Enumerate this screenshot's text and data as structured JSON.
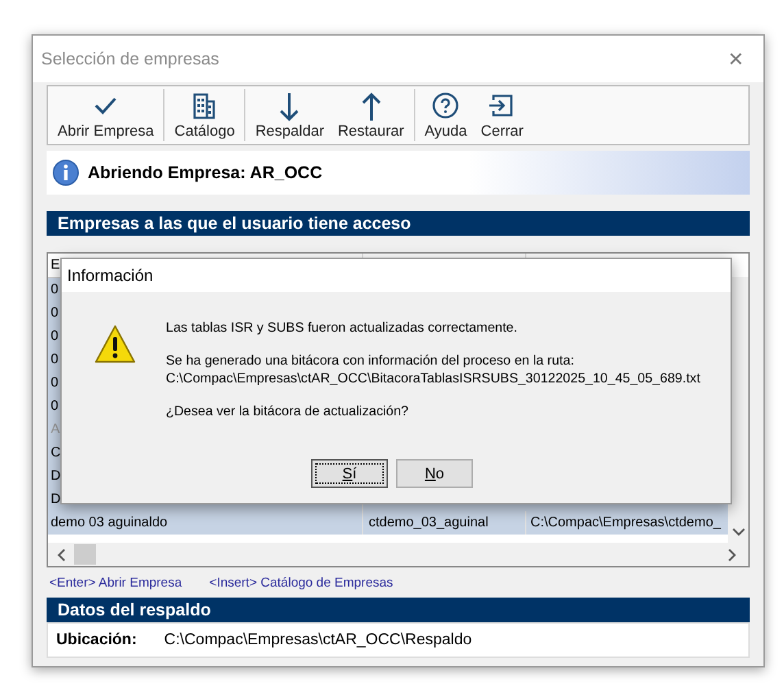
{
  "window": {
    "title": "Selección de empresas",
    "close": "✕"
  },
  "toolbar": {
    "groups": [
      [
        {
          "label": "Abrir Empresa"
        }
      ],
      [
        {
          "label": "Catálogo"
        }
      ],
      [
        {
          "label": "Respaldar"
        },
        {
          "label": "Restaurar"
        }
      ],
      [
        {
          "label": "Ayuda"
        },
        {
          "label": "Cerrar"
        }
      ]
    ]
  },
  "info_bar": {
    "text": "Abriendo Empresa: AR_OCC"
  },
  "companies": {
    "title": "Empresas a las que el usuario tiene acceso",
    "table": {
      "header": "E",
      "rows": [
        {
          "cells": [
            "0"
          ],
          "selected": true,
          "disabled": false
        },
        {
          "cells": [
            "0"
          ],
          "selected": true,
          "disabled": false
        },
        {
          "cells": [
            "0"
          ],
          "selected": true,
          "disabled": false
        },
        {
          "cells": [
            "0"
          ],
          "selected": true,
          "disabled": false
        },
        {
          "cells": [
            "0"
          ],
          "selected": true,
          "disabled": false
        },
        {
          "cells": [
            "0"
          ],
          "selected": true,
          "disabled": false
        },
        {
          "cells": [
            "A"
          ],
          "selected": true,
          "disabled": true
        },
        {
          "cells": [
            "C"
          ],
          "selected": true,
          "disabled": false
        },
        {
          "cells": [
            "D"
          ],
          "selected": true,
          "disabled": false
        },
        {
          "cells": [
            "D"
          ],
          "selected": true,
          "disabled": false
        },
        {
          "cells": [
            "demo 03 aguinaldo",
            "ctdemo_03_aguinal",
            "C:\\Compac\\Empresas\\ctdemo_"
          ],
          "selected": true,
          "disabled": false
        }
      ]
    },
    "hints": [
      "<Enter> Abrir Empresa",
      "<Insert> Catálogo de Empresas"
    ]
  },
  "backup": {
    "title": "Datos del respaldo",
    "label": "Ubicación:",
    "value": "C:\\Compac\\Empresas\\ctAR_OCC\\Respaldo"
  },
  "dialog": {
    "title": "Información",
    "messages": [
      "Las tablas ISR y SUBS fueron actualizadas correctamente.",
      "Se ha generado una bitácora con información del proceso en la ruta:\nC:\\Compac\\Empresas\\ctAR_OCC\\BitacoraTablasISRSUBS_30122025_10_45_05_689.txt",
      "¿Desea ver la bitácora de actualización?"
    ],
    "buttons": [
      {
        "label": "Sí",
        "selected": true
      },
      {
        "label": "No",
        "selected": false
      }
    ]
  }
}
